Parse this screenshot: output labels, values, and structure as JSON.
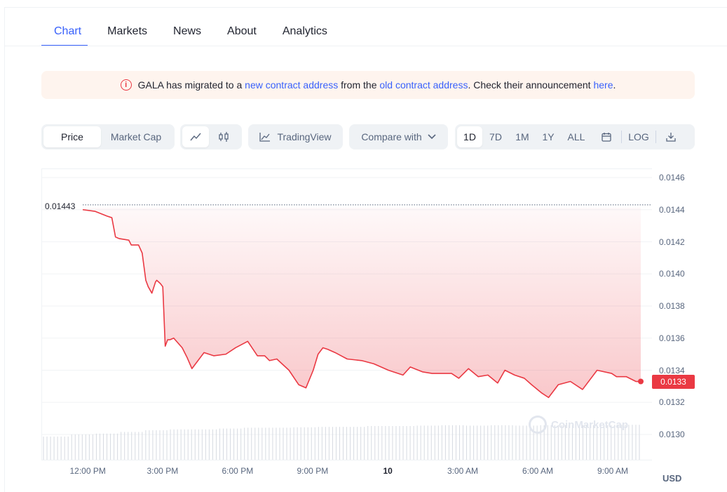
{
  "tabs": [
    "Chart",
    "Markets",
    "News",
    "About",
    "Analytics"
  ],
  "banner": {
    "t1": "GALA has migrated to a ",
    "link1": "new contract address",
    "t2": " from the ",
    "link2": "old contract address",
    "t3": ". Check their announcement ",
    "link3": "here",
    "t4": "."
  },
  "toolbar": {
    "price": "Price",
    "market_cap": "Market Cap",
    "tradingview": "TradingView",
    "compare": "Compare with",
    "ranges": [
      "1D",
      "7D",
      "1M",
      "1Y",
      "ALL"
    ],
    "log": "LOG"
  },
  "colors": {
    "accent": "#3861fb",
    "down": "#ea3943",
    "banner_bg": "#fef4ee"
  },
  "icons": [
    "info-icon",
    "line-chart-icon",
    "candlestick-icon",
    "tradingview-icon",
    "chevron-down-icon",
    "calendar-icon",
    "download-icon",
    "coinmarketcap-logo-icon"
  ],
  "chart_data": {
    "type": "line",
    "ylabel": "USD",
    "ylim": [
      0.0128,
      0.0147
    ],
    "y_ticks": [
      "0.0146",
      "0.0144",
      "0.0142",
      "0.0140",
      "0.0138",
      "0.0136",
      "0.0134",
      "0.0132",
      "0.0130"
    ],
    "x_ticks": [
      "12:00 PM",
      "3:00 PM",
      "6:00 PM",
      "9:00 PM",
      "10",
      "3:00 AM",
      "6:00 AM",
      "9:00 AM"
    ],
    "high_label": "0.01443",
    "current_price": "0.0133",
    "watermark": "CoinMarketCap",
    "series": [
      {
        "x": [
          0.0,
          0.5,
          1.0,
          1.2,
          1.35,
          1.5,
          1.9,
          2.0,
          2.3,
          2.45,
          2.6,
          2.7,
          2.85,
          3.0,
          3.05,
          3.2,
          3.3,
          3.4,
          3.5,
          3.6,
          3.75,
          4.1,
          4.3,
          4.5,
          4.8,
          5.0,
          5.4,
          5.9,
          6.3,
          6.8,
          7.2,
          7.5,
          7.7,
          8.0,
          8.5,
          8.9,
          9.2,
          9.5,
          9.7,
          9.9,
          10.1,
          10.4,
          10.9,
          11.5,
          12.0,
          12.6,
          13.2,
          13.5,
          14.0,
          14.4,
          14.8,
          15.2,
          15.5,
          15.9,
          16.3,
          16.7,
          17.1,
          17.4,
          17.8,
          18.2,
          18.5,
          18.9,
          19.2,
          19.6,
          20.1,
          20.6,
          21.2,
          21.8,
          22.0,
          22.4,
          22.8,
          23.0
        ],
        "values": [
          0.0144,
          0.01439,
          0.01436,
          0.01435,
          0.01423,
          0.01422,
          0.01421,
          0.01418,
          0.01418,
          0.01413,
          0.01396,
          0.01392,
          0.01388,
          0.01395,
          0.01396,
          0.01394,
          0.01392,
          0.01355,
          0.01359,
          0.01359,
          0.0136,
          0.01354,
          0.01348,
          0.01341,
          0.01347,
          0.01351,
          0.01349,
          0.0135,
          0.01354,
          0.01358,
          0.01349,
          0.01349,
          0.01346,
          0.01347,
          0.0134,
          0.01331,
          0.01329,
          0.0134,
          0.0135,
          0.01354,
          0.01353,
          0.01351,
          0.01347,
          0.01346,
          0.01344,
          0.0134,
          0.01337,
          0.01342,
          0.01339,
          0.01338,
          0.01338,
          0.01338,
          0.01335,
          0.01341,
          0.01336,
          0.01337,
          0.01332,
          0.0134,
          0.01337,
          0.01335,
          0.01331,
          0.01326,
          0.01323,
          0.01331,
          0.01333,
          0.01328,
          0.0134,
          0.01338,
          0.01336,
          0.01336,
          0.01333,
          0.01333
        ]
      }
    ],
    "volume_relative": [
      0.55,
      0.6,
      0.62,
      0.66,
      0.7,
      0.72,
      0.72,
      0.74,
      0.76,
      0.76,
      0.77,
      0.78,
      0.78,
      0.8,
      0.8,
      0.81,
      0.82,
      0.81,
      0.82,
      0.81,
      0.82,
      0.82,
      0.82,
      0.83
    ]
  }
}
